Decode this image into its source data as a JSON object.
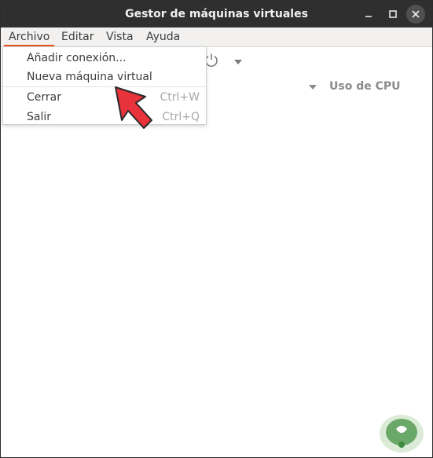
{
  "window": {
    "title": "Gestor de máquinas virtuales",
    "controls": {
      "minimize": "minimize-icon",
      "maximize": "maximize-icon",
      "close": "close-icon"
    }
  },
  "menubar": {
    "items": [
      {
        "label": "Archivo",
        "active": true
      },
      {
        "label": "Editar"
      },
      {
        "label": "Vista"
      },
      {
        "label": "Ayuda"
      }
    ]
  },
  "dropdown": {
    "items": [
      {
        "label": "Añadir conexión...",
        "shortcut": ""
      },
      {
        "label": "Nueva máquina virtual",
        "shortcut": ""
      },
      {
        "label": "Cerrar",
        "shortcut": "Ctrl+W"
      },
      {
        "label": "Salir",
        "shortcut": "Ctrl+Q"
      }
    ]
  },
  "table": {
    "column_header": "Uso de CPU"
  },
  "colors": {
    "titlebar": "#2f2f2f",
    "menu_active_underline": "#e95420",
    "arrow": "#e8323c",
    "logo_green": "#3c8c3c"
  }
}
